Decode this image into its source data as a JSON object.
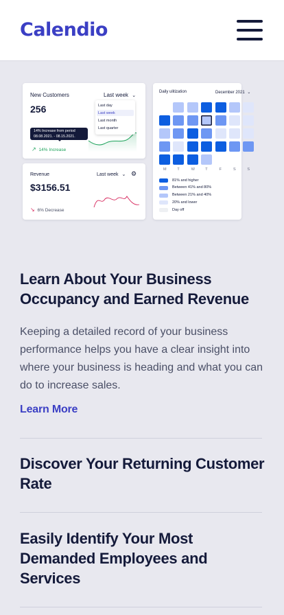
{
  "header": {
    "logo": "Calendio",
    "menu_icon": "hamburger-menu-icon"
  },
  "customers_card": {
    "title": "New Customers",
    "period": "Last week",
    "value": "256",
    "dropdown_options": [
      "Last day",
      "Last week",
      "Last month",
      "Last quarter"
    ],
    "selected_option": "Last week",
    "tooltip_line1": "14% Increase from period",
    "tooltip_line2": "08.08.2021. - 08.15.2021.",
    "change": "14% Increase",
    "change_icon": "arrow-up-right-icon",
    "change_color": "#1fa35c"
  },
  "revenue_card": {
    "title": "Revenue",
    "period": "Last week",
    "value": "$3156.51",
    "change": "6% Decrease",
    "change_icon": "arrow-down-right-icon",
    "change_color": "#d6245a",
    "settings_icon": "gear-icon"
  },
  "utilization_card": {
    "title": "Daily ulitization",
    "month": "December 2021",
    "weekdays": [
      "M",
      "T",
      "W",
      "T",
      "F",
      "S",
      "S"
    ],
    "grid_levels": [
      [
        null,
        2,
        2,
        4,
        4,
        2,
        1
      ],
      [
        4,
        3,
        3,
        2,
        3,
        1,
        1
      ],
      [
        2,
        3,
        4,
        3,
        1,
        1,
        1
      ],
      [
        3,
        1,
        4,
        4,
        4,
        3,
        3
      ],
      [
        4,
        4,
        4,
        2,
        null,
        null,
        null
      ]
    ],
    "highlighted_day": [
      1,
      3
    ],
    "level_colors": [
      "#eef0f3",
      "#dfe6fb",
      "#b4c7fa",
      "#6e97f3",
      "#0d5ee0"
    ],
    "legend": [
      {
        "label": "81% and higher",
        "level": 4
      },
      {
        "label": "Between 41% and 80%",
        "level": 3
      },
      {
        "label": "Between 21% and 40%",
        "level": 2
      },
      {
        "label": "20% and lower",
        "level": 1
      },
      {
        "label": "Day off",
        "level": 0
      }
    ]
  },
  "sections": {
    "occupancy_title": "Learn About Your Business Occupancy and Earned Revenue",
    "occupancy_body": "Keeping a detailed record of your business performance helps you have a clear insight into where your business is heading and what you can do to increase sales.",
    "learn_more": "Learn More",
    "returning_title": "Discover Your Returning Customer Rate",
    "employees_title": "Easily Identify Your Most Demanded Employees and Services"
  }
}
